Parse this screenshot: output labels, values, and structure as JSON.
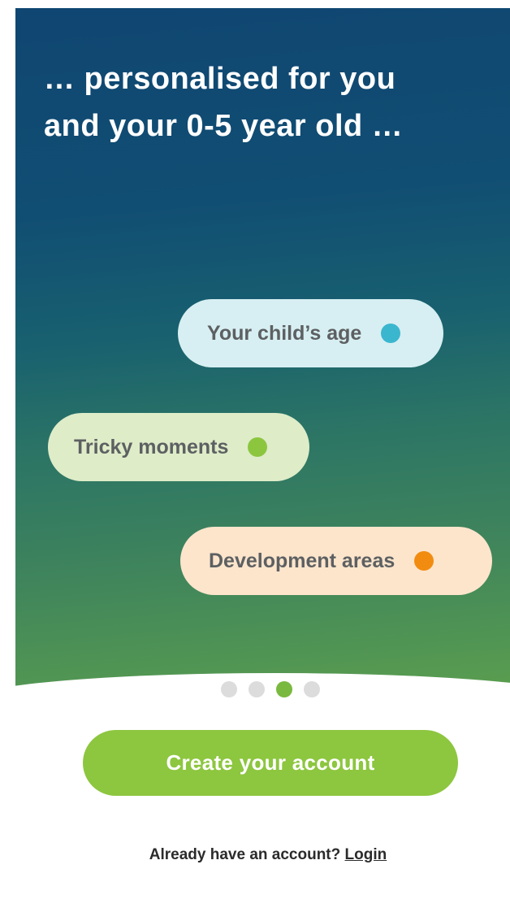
{
  "hero": {
    "headline_line1": "… personalised for you",
    "headline_line2": "and your 0-5 year old …"
  },
  "pills": [
    {
      "label": "Your child’s age",
      "dot_color": "#3bb6cf",
      "background": "#d7eff2"
    },
    {
      "label": "Tricky moments",
      "dot_color": "#8cc63f",
      "background": "#deecc8"
    },
    {
      "label": "Development areas",
      "dot_color": "#f28c10",
      "background": "#fde5cc"
    }
  ],
  "pager": {
    "total_pages": 4,
    "active_page": 3,
    "active_color": "#7ab93f",
    "inactive_color": "#dcdcdc"
  },
  "cta": {
    "label": "Create your account",
    "color": "#8dc63f"
  },
  "login": {
    "prompt": "Already have an account?",
    "link_label": "Login"
  }
}
